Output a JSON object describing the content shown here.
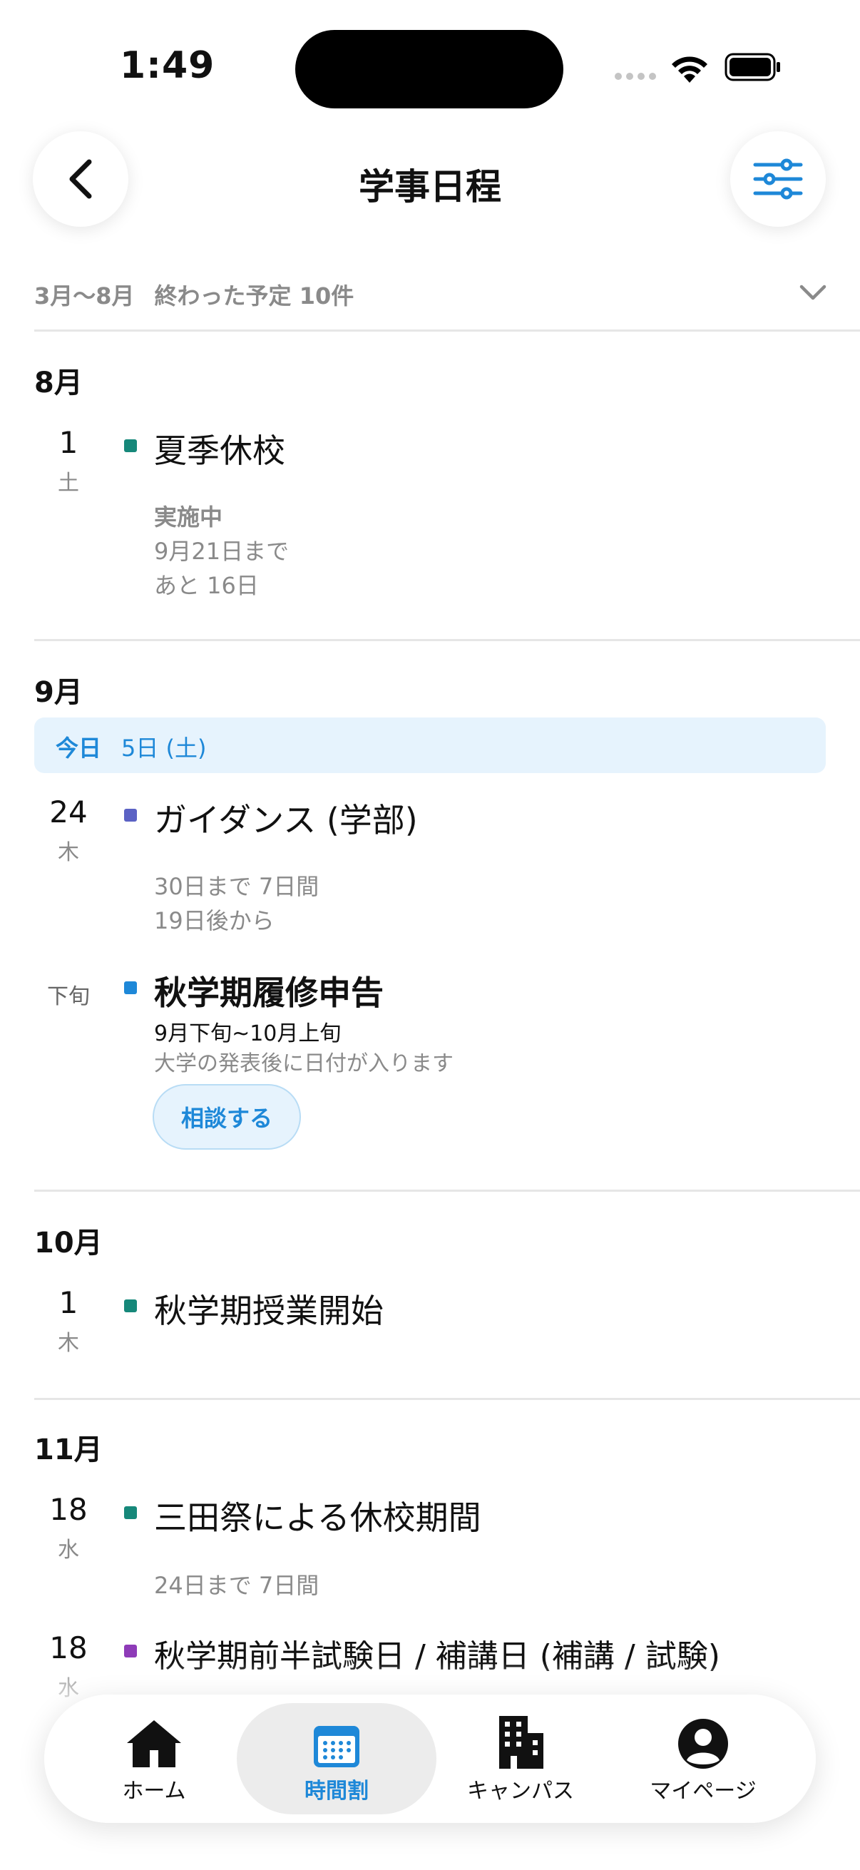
{
  "status_bar": {
    "time": "1:49"
  },
  "header": {
    "title": "学事日程"
  },
  "past": {
    "range": "3月〜8月",
    "summary": "終わった予定 10件"
  },
  "months": {
    "aug": {
      "label": "8月",
      "events": [
        {
          "day": "1",
          "dow": "土",
          "title": "夏季休校",
          "color": "#16887a",
          "status": "実施中",
          "until": "9月21日まで",
          "remaining": "あと 16日"
        }
      ]
    },
    "sep": {
      "label": "9月",
      "today_label": "今日",
      "today_date": "5日 (土)",
      "events": [
        {
          "day": "24",
          "dow": "木",
          "title": "ガイダンス (学部)",
          "color": "#5b62c4",
          "line1": "30日まで  7日間",
          "line2": "19日後から"
        },
        {
          "day": "下旬",
          "title": "秋学期履修申告",
          "color": "#1e88d8",
          "period": "9月下旬~10月上旬",
          "note": "大学の発表後に日付が入ります",
          "button": "相談する"
        }
      ]
    },
    "oct": {
      "label": "10月",
      "events": [
        {
          "day": "1",
          "dow": "木",
          "title": "秋学期授業開始",
          "color": "#16887a"
        }
      ]
    },
    "nov": {
      "label": "11月",
      "events": [
        {
          "day": "18",
          "dow": "水",
          "title": "三田祭による休校期間",
          "color": "#16887a",
          "line1": "24日まで  7日間"
        },
        {
          "day": "18",
          "dow": "水",
          "title": "秋学期前半試験日 / 補講日 (補講 / 試験)",
          "color": "#8e3bb8"
        }
      ]
    }
  },
  "tabs": [
    {
      "label": "ホーム",
      "icon": "home-icon"
    },
    {
      "label": "時間割",
      "icon": "calendar-icon",
      "active": true
    },
    {
      "label": "キャンパス",
      "icon": "building-icon"
    },
    {
      "label": "マイページ",
      "icon": "person-icon"
    }
  ],
  "colors": {
    "accent": "#1e88d8",
    "today_bg": "#e6f3fd"
  }
}
